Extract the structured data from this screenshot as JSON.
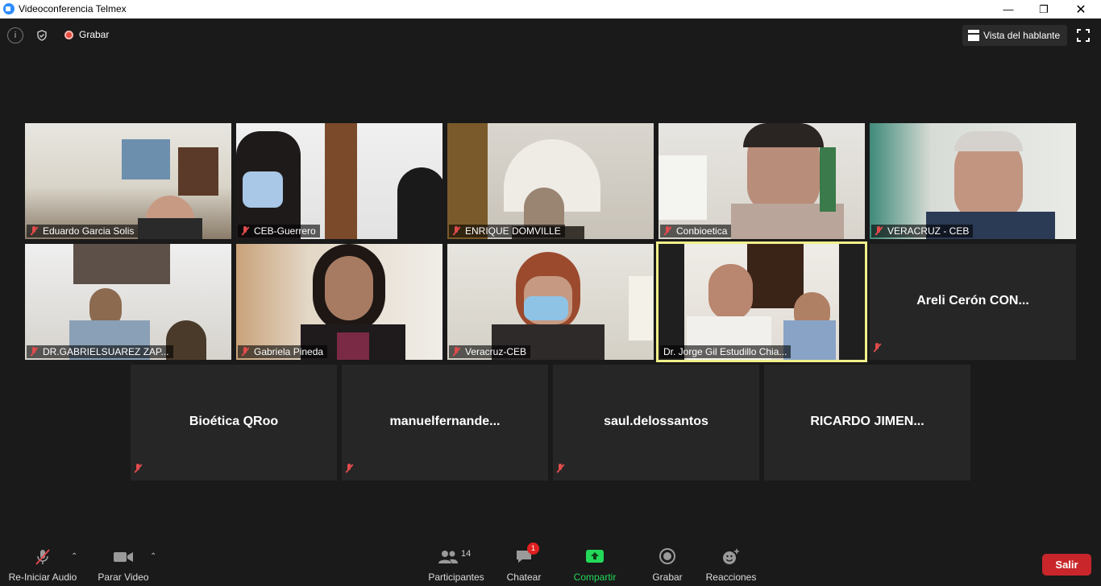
{
  "window": {
    "title": "Videoconferencia Telmex"
  },
  "topbar": {
    "record_label": "Grabar",
    "speaker_view_label": "Vista del hablante"
  },
  "participants_grid": [
    {
      "name": "Eduardo Garcia Solis",
      "video": true,
      "muted": true
    },
    {
      "name": "CEB-Guerrero",
      "video": true,
      "muted": true
    },
    {
      "name": "ENRIQUE DOMVILLE",
      "video": true,
      "muted": true
    },
    {
      "name": "Conbioetica",
      "video": true,
      "muted": true
    },
    {
      "name": "VERACRUZ - CEB",
      "video": true,
      "muted": true
    },
    {
      "name": "DR.GABRIELSUAREZ ZAP...",
      "video": true,
      "muted": true
    },
    {
      "name": "Gabriela Pineda",
      "video": true,
      "muted": true
    },
    {
      "name": "Veracruz-CEB",
      "video": true,
      "muted": true
    },
    {
      "name": "Dr. Jorge Gil Estudillo Chia...",
      "video": true,
      "muted": false,
      "active_speaker": true
    },
    {
      "name": "Areli Cerón CON...",
      "video": false,
      "muted": true
    },
    {
      "name": "Bioética QRoo",
      "video": false,
      "muted": true
    },
    {
      "name": "manuelfernande...",
      "video": false,
      "muted": true
    },
    {
      "name": "saul.delossantos",
      "video": false,
      "muted": true
    },
    {
      "name": "RICARDO  JIMEN...",
      "video": false,
      "muted": false
    }
  ],
  "toolbar": {
    "audio_label": "Re-Iniciar Audio",
    "video_label": "Parar Video",
    "participants_label": "Participantes",
    "participants_count": "14",
    "chat_label": "Chatear",
    "chat_badge": "1",
    "share_label": "Compartir",
    "record_label": "Grabar",
    "reactions_label": "Reacciones",
    "leave_label": "Salir"
  },
  "colors": {
    "background": "#1a1a1a",
    "tile": "#262626",
    "active_speaker_border": "#f0f08a",
    "share_green": "#23d959",
    "leave_red": "#c8262b",
    "mute_red": "#e04b4b"
  }
}
